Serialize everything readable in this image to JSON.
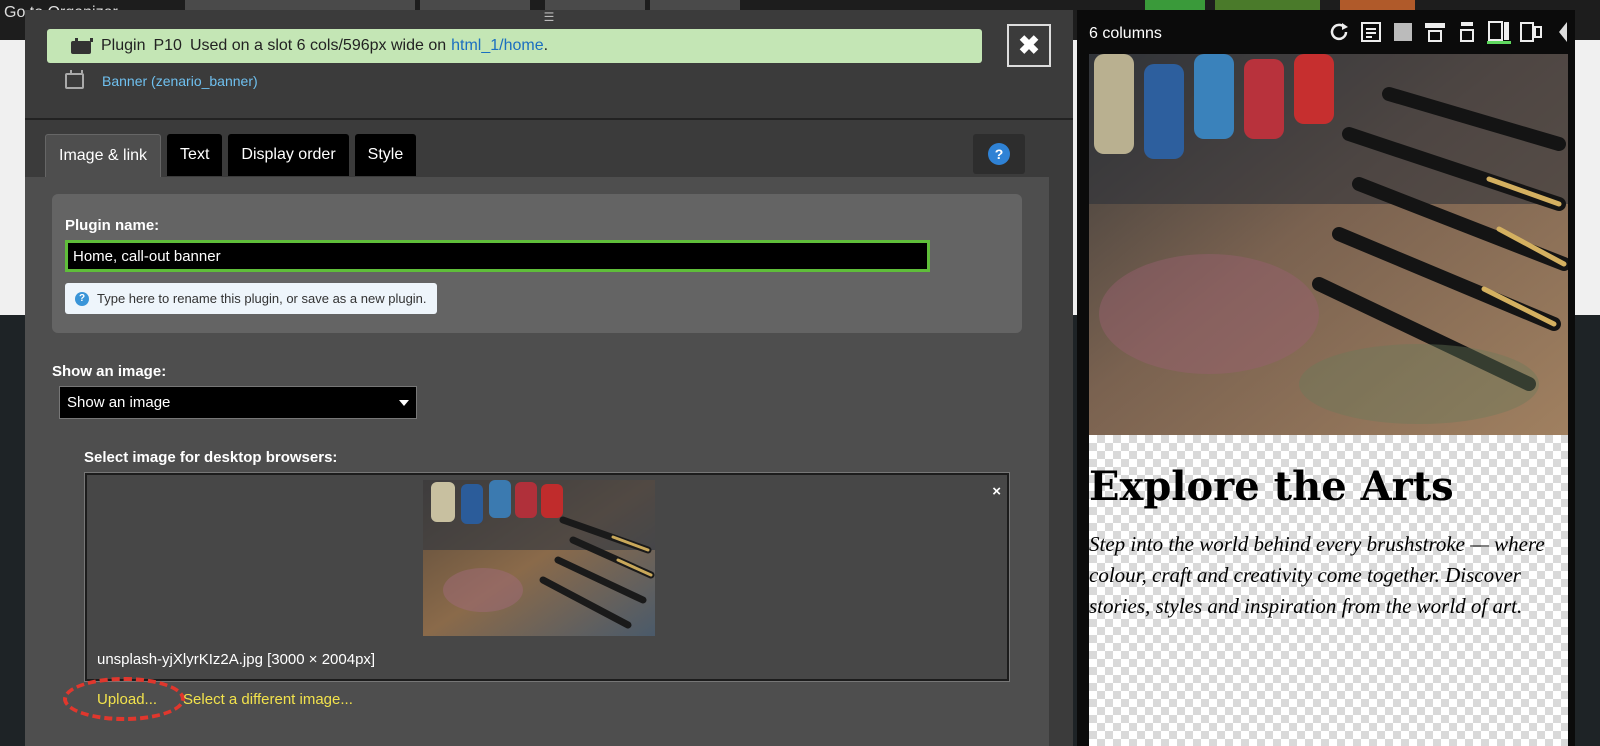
{
  "background": {
    "goto_label": "Go to Organizer"
  },
  "modal": {
    "notice": {
      "label": "Plugin",
      "code": "P10",
      "text": "Used on a slot 6 cols/596px wide on",
      "link": "html_1/home",
      "suffix": "."
    },
    "banner_link": "Banner (zenario_banner)",
    "close_symbol": "✖",
    "tabs": [
      {
        "label": "Image & link",
        "active": true
      },
      {
        "label": "Text",
        "active": false
      },
      {
        "label": "Display order",
        "active": false
      },
      {
        "label": "Style",
        "active": false
      }
    ],
    "help_symbol": "?",
    "plugin_name_label": "Plugin name:",
    "plugin_name_value": "Home, call-out banner",
    "plugin_name_hint": "Type here to rename this plugin, or save as a new plugin.",
    "show_image_label": "Show an image:",
    "show_image_selected": "Show an image",
    "desktop_image_label": "Select image for desktop browsers:",
    "image_filename": "unsplash-yjXlyrKIz2A.jpg [3000 × 2004px]",
    "remove_symbol": "×",
    "upload_label": "Upload...",
    "select_different_label": "Select a different image..."
  },
  "preview": {
    "columns_label": "6 columns",
    "title": "Explore the Arts",
    "text": "Step into the world behind every brushstroke — where colour, craft and creativity come together. Discover stories, styles and inspiration from the world of art.",
    "toolbar_icons": [
      "refresh-icon",
      "page-icon",
      "square-icon",
      "layout-top-icon",
      "layout-middle-icon",
      "layout-side-icon",
      "layout-split-icon"
    ]
  },
  "colors": {
    "notice_bg": "#c4e6b5",
    "input_border": "#5fbe3a",
    "link": "#6fc0ef",
    "action_link": "#f2e24c",
    "highlight_ring": "#e0372d"
  }
}
